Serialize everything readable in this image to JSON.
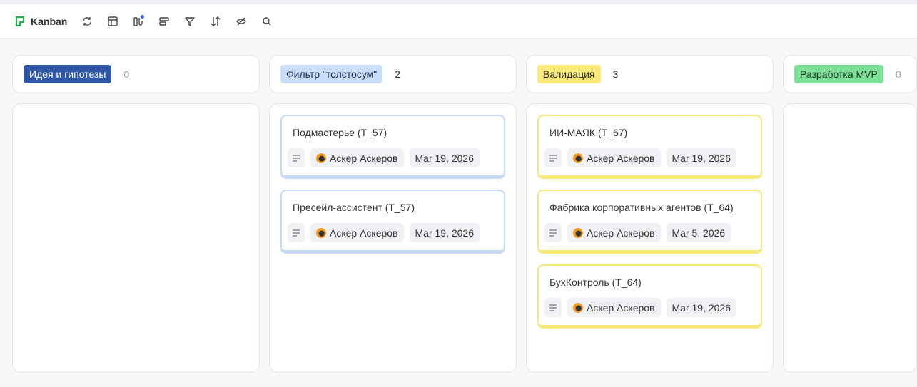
{
  "toolbar": {
    "title": "Kanban",
    "brand_color": "#22b24c",
    "icons": [
      "refresh-icon",
      "layout-icon",
      "group-by-icon",
      "card-layout-icon",
      "filter-icon",
      "sort-icon",
      "hide-fields-icon",
      "search-icon"
    ]
  },
  "columns": [
    {
      "label": "Идея и гипотезы",
      "count": "0",
      "tag_bg": "#2f57a5",
      "tag_fg": "#ffffff",
      "card_border": "#c5daf7",
      "cards": []
    },
    {
      "label": "Фильтр \"толстосум\"",
      "count": "2",
      "tag_bg": "#c9defb",
      "tag_fg": "#1e2b44",
      "card_border": "#c5daf7",
      "cards": [
        {
          "title": "Подмастерье (T_57)",
          "user": "Аскер Аскеров",
          "date": "Mar 19, 2026"
        },
        {
          "title": "Пресейл-ассистент (T_57)",
          "user": "Аскер Аскеров",
          "date": "Mar 19, 2026"
        }
      ]
    },
    {
      "label": "Валидация",
      "count": "3",
      "tag_bg": "#fbe97a",
      "tag_fg": "#2b2a1a",
      "card_border": "#f8e77c",
      "cards": [
        {
          "title": "ИИ-МАЯК (T_67)",
          "user": "Аскер Аскеров",
          "date": "Mar 19, 2026"
        },
        {
          "title": "Фабрика корпоративных агентов (T_64)",
          "user": "Аскер Аскеров",
          "date": "Mar 5, 2026"
        },
        {
          "title": "БухКонтроль (T_64)",
          "user": "Аскер Аскеров",
          "date": "Mar 19, 2026"
        }
      ]
    },
    {
      "label": "Разработка MVP",
      "count": "0",
      "tag_bg": "#7ddf98",
      "tag_fg": "#1b3a22",
      "card_border": "#7ddf98",
      "cards": []
    }
  ]
}
